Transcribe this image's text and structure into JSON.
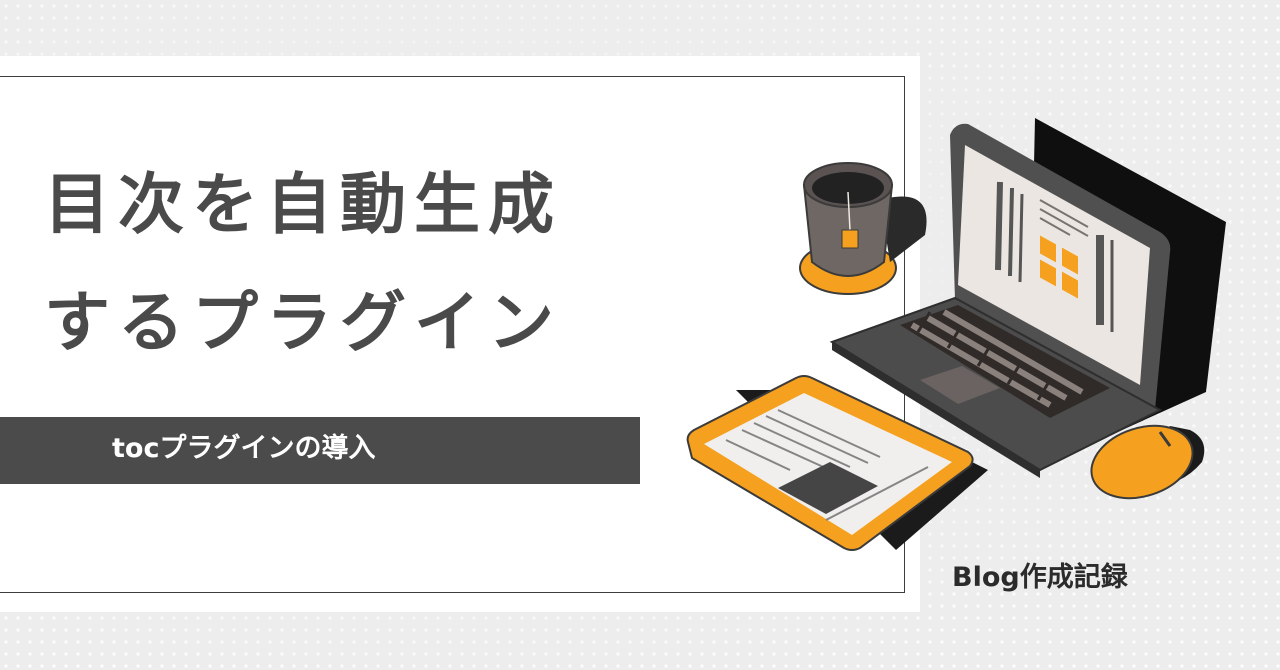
{
  "title": {
    "line1": "目次を自動生成",
    "line2": "するプラグイン"
  },
  "subtitle": "tocプラグインの導入",
  "blog_label": "Blog作成記録",
  "colors": {
    "background": "#ededed",
    "panel": "#ffffff",
    "text_dark": "#4a4a4a",
    "band": "#4b4b4b",
    "accent": "#f5a01e",
    "device_dark": "#505050"
  },
  "illustration": {
    "items": [
      "coffee-cup-icon",
      "coaster-icon",
      "tea-bag-icon",
      "laptop-icon",
      "laptop-screen-icon",
      "keyboard-icon",
      "touchpad-icon",
      "document-tablet-icon",
      "mouse-icon"
    ]
  }
}
